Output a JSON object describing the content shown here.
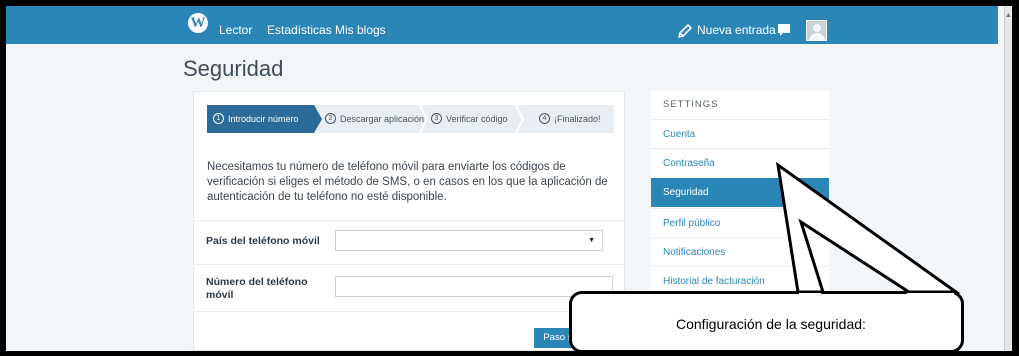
{
  "topbar": {
    "logo_letter": "W",
    "nav": [
      "Lector",
      "Estadísticas",
      "Mis blogs"
    ],
    "new_post_label": "Nueva entrada"
  },
  "page_title": "Seguridad",
  "steps": [
    {
      "num": "1",
      "label": "Introducir número",
      "active": true
    },
    {
      "num": "2",
      "label": "Descargar aplicación",
      "active": false
    },
    {
      "num": "3",
      "label": "Verificar código",
      "active": false
    },
    {
      "num": "4",
      "label": "¡Finalizado!",
      "active": false
    }
  ],
  "intro_text": "Necesitamos tu número de teléfono móvil para enviarte los códigos de verificación si eliges el método de SMS, o en casos en los que la aplicación de autenticación de tu teléfono no esté disponible.",
  "form": {
    "country_label": "País del teléfono móvil",
    "country_value": "",
    "phone_label": "Número del teléfono móvil",
    "phone_value": "",
    "next_button": "Paso siguiente"
  },
  "settings": {
    "heading": "SETTINGS",
    "items": [
      "Cuenta",
      "Contraseña",
      "Seguridad",
      "Perfil público",
      "Notificaciones",
      "Historial de facturación"
    ],
    "active_index": 2
  },
  "annotation": {
    "text": "Configuración de la seguridad:"
  },
  "colors": {
    "topbar": "#2b86b8",
    "step_active": "#2c6a98",
    "link": "#2b86b8",
    "background": "#f3f6f8"
  }
}
